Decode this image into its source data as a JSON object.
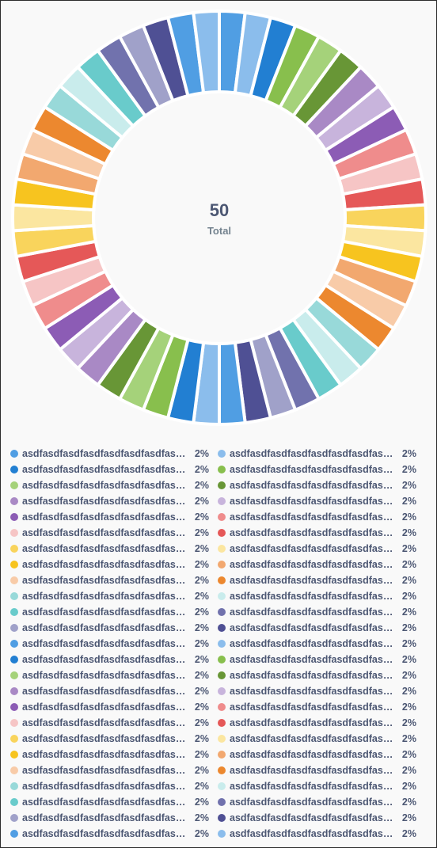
{
  "chart_data": {
    "type": "pie",
    "center_value": "50",
    "center_label": "Total",
    "label": "asdfasdfasdfasdfasdfasdfasdfas…",
    "percent": "2%",
    "values": [
      1,
      1,
      1,
      1,
      1,
      1,
      1,
      1,
      1,
      1,
      1,
      1,
      1,
      1,
      1,
      1,
      1,
      1,
      1,
      1,
      1,
      1,
      1,
      1,
      1,
      1,
      1,
      1,
      1,
      1,
      1,
      1,
      1,
      1,
      1,
      1,
      1,
      1,
      1,
      1,
      1,
      1,
      1,
      1,
      1,
      1,
      1,
      1,
      1,
      1
    ],
    "colors": [
      "#509ee3",
      "#8bbdec",
      "#227fd2",
      "#88bf4d",
      "#a5d27a",
      "#689636",
      "#a989c5",
      "#c8b4dc",
      "#8c5cb5",
      "#ef8c8c",
      "#f6c5c5",
      "#e55858",
      "#f9d45c",
      "#fbe6a0",
      "#f7c41f",
      "#f2a86f",
      "#f8cba8",
      "#ec882f",
      "#98d9d9",
      "#c9ecec",
      "#69cbcb",
      "#7172ad",
      "#a0a1c9",
      "#4f5094",
      "#509ee3",
      "#8bbdec",
      "#227fd2",
      "#88bf4d",
      "#a5d27a",
      "#689636",
      "#a989c5",
      "#c8b4dc",
      "#8c5cb5",
      "#ef8c8c",
      "#f6c5c5",
      "#e55858",
      "#f9d45c",
      "#fbe6a0",
      "#f7c41f",
      "#f2a86f",
      "#f8cba8",
      "#ec882f",
      "#98d9d9",
      "#c9ecec",
      "#69cbcb",
      "#7172ad",
      "#a0a1c9",
      "#4f5094",
      "#509ee3",
      "#8bbdec"
    ]
  }
}
